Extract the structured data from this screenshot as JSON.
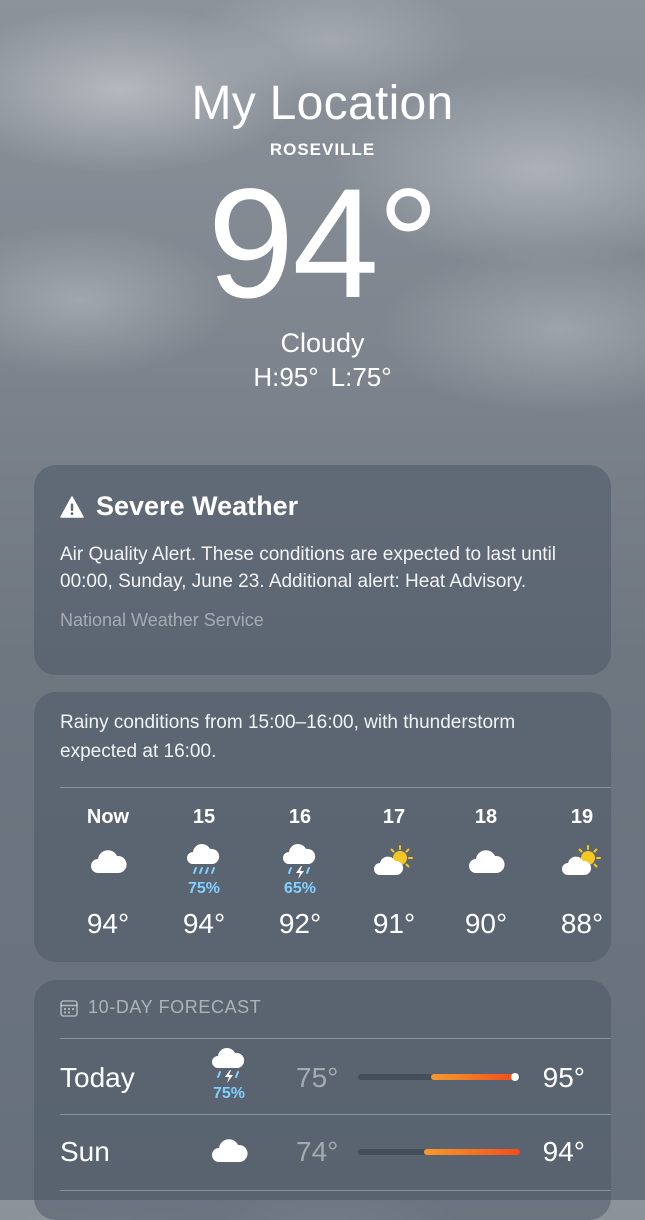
{
  "location": {
    "title": "My Location",
    "city": "ROSEVILLE"
  },
  "current": {
    "temp": "94°",
    "condition": "Cloudy",
    "high": "H:95°",
    "low": "L:75°"
  },
  "alert": {
    "title": "Severe Weather",
    "body": "Air Quality Alert. These conditions are expected to last until 00:00, Sunday, June 23. Additional alert: Heat Advisory.",
    "source": "National Weather Service"
  },
  "hourly": {
    "summary": "Rainy conditions from 15:00–16:00, with thunderstorm expected at 16:00.",
    "hours": [
      {
        "label": "Now",
        "icon": "cloud-icon",
        "precip": "",
        "temp": "94°"
      },
      {
        "label": "15",
        "icon": "cloud-rain-icon",
        "precip": "75%",
        "temp": "94°"
      },
      {
        "label": "16",
        "icon": "cloud-thunderstorm-icon",
        "precip": "65%",
        "temp": "92°"
      },
      {
        "label": "17",
        "icon": "partly-sunny-icon",
        "precip": "",
        "temp": "91°"
      },
      {
        "label": "18",
        "icon": "cloud-icon",
        "precip": "",
        "temp": "90°"
      },
      {
        "label": "19",
        "icon": "partly-sunny-icon",
        "precip": "",
        "temp": "88°"
      }
    ]
  },
  "forecast": {
    "header": "10-DAY FORECAST",
    "days": [
      {
        "day": "Today",
        "icon": "cloud-thunderstorm-icon",
        "precip": "75%",
        "low": "75°",
        "high": "95°",
        "range_start": 0.45,
        "range_end": 0.97,
        "current_marker": 0.97
      },
      {
        "day": "Sun",
        "icon": "cloud-icon",
        "precip": "",
        "low": "74°",
        "high": "94°",
        "range_start": 0.41,
        "range_end": 1.0
      }
    ]
  },
  "colors": {
    "precip": "#7fd1ff",
    "range_start": "#f79a2c",
    "range_end": "#f24d1c",
    "sun": "#f6c623"
  }
}
